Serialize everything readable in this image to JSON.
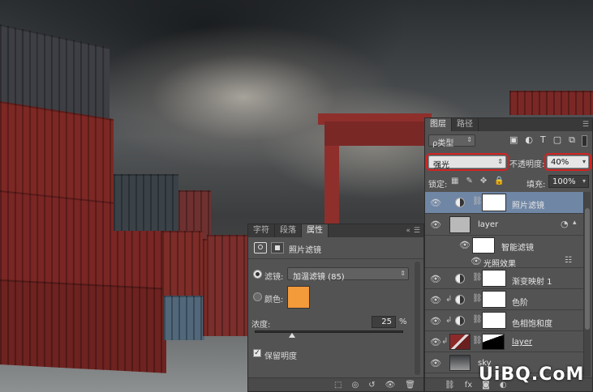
{
  "layers_panel": {
    "tabs": [
      "图层",
      "路径"
    ],
    "kind_filter": "ρ类型",
    "blend_mode": "强光",
    "opacity_label": "不透明度:",
    "opacity_value": "40%",
    "lock_label": "锁定:",
    "fill_label": "填充:",
    "fill_value": "100%",
    "layers": [
      {
        "name": "照片滤镜",
        "type": "adjustment",
        "selected": true
      },
      {
        "name": "layer",
        "type": "smart-object"
      },
      {
        "name": "智能滤镜",
        "type": "smart-filter-mask"
      },
      {
        "name": "光照效果",
        "type": "filter-item"
      },
      {
        "name": "渐变映射 1",
        "type": "adjustment"
      },
      {
        "name": "色阶",
        "type": "adjustment",
        "clipped": true
      },
      {
        "name": "色相饱和度",
        "type": "adjustment",
        "clipped": true
      },
      {
        "name": "layer",
        "type": "pixel-with-mask",
        "clipped": true
      },
      {
        "name": "sky",
        "type": "pixel"
      }
    ]
  },
  "properties_panel": {
    "tabs": [
      "字符",
      "段落",
      "属性"
    ],
    "title": "照片滤镜",
    "filter_radio_label": "滤镜:",
    "filter_value": "加温滤镜 (85)",
    "color_radio_label": "颜色:",
    "color_swatch": "#f39a3a",
    "density_label": "浓度:",
    "density_value": "25",
    "density_unit": "%",
    "density_fraction": 0.25,
    "preserve_label": "保留明度",
    "preserve_checked": true
  },
  "colors": {
    "panel_bg": "#535353",
    "tab_bar": "#393939",
    "selected_row": "#6f86a5",
    "highlight_outline": "#d32424",
    "container_red": "#7a2624"
  },
  "watermark": "UiBQ.CoM"
}
